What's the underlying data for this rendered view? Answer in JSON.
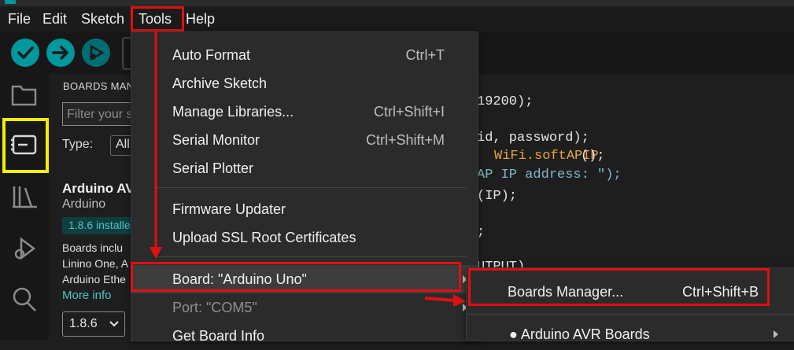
{
  "menubar": {
    "file": "File",
    "edit": "Edit",
    "sketch": "Sketch",
    "tools": "Tools",
    "help": "Help"
  },
  "sidebar_panel": {
    "title": "BOARDS MANAGER",
    "title_visible": "BOARDS MAN",
    "filter_placeholder": "Filter your s",
    "type_label": "Type:",
    "type_value": "All",
    "board_name": "Arduino AV",
    "board_author": "Arduino",
    "installed_badge": "1.8.6 installe",
    "desc_line1": "Boards inclu",
    "desc_line2": "Linino One, A",
    "desc_line3": "Arduino Ethe",
    "more_info": "More info",
    "version_select": "1.8.6"
  },
  "editor": {
    "line1": "19200);",
    "line2a": "id, password);",
    "line3_func": "WiFi.softAPIP",
    "line3_end": "();",
    "line4": "AP IP address: \");",
    "line5": "(IP);",
    "line6": ";",
    "line7": "UTPUT)"
  },
  "tools_menu": {
    "items": [
      {
        "label": "Auto Format",
        "shortcut": "Ctrl+T"
      },
      {
        "label": "Archive Sketch",
        "shortcut": ""
      },
      {
        "label": "Manage Libraries...",
        "shortcut": "Ctrl+Shift+I"
      },
      {
        "label": "Serial Monitor",
        "shortcut": "Ctrl+Shift+M"
      },
      {
        "label": "Serial Plotter",
        "shortcut": ""
      },
      {
        "label": "Firmware Updater",
        "shortcut": ""
      },
      {
        "label": "Upload SSL Root Certificates",
        "shortcut": ""
      },
      {
        "label": "Board: \"Arduino Uno\"",
        "shortcut": ""
      },
      {
        "label": "Port: \"COM5\"",
        "shortcut": ""
      },
      {
        "label": "Get Board Info",
        "shortcut": ""
      }
    ]
  },
  "board_submenu": {
    "items": [
      {
        "label": "Boards Manager...",
        "shortcut": "Ctrl+Shift+B"
      },
      {
        "label": "● Arduino AVR Boards",
        "shortcut": ""
      }
    ]
  },
  "colors": {
    "annotation_red": "#e01010",
    "highlight_yellow": "#f4f000",
    "teal": "#00979d"
  }
}
